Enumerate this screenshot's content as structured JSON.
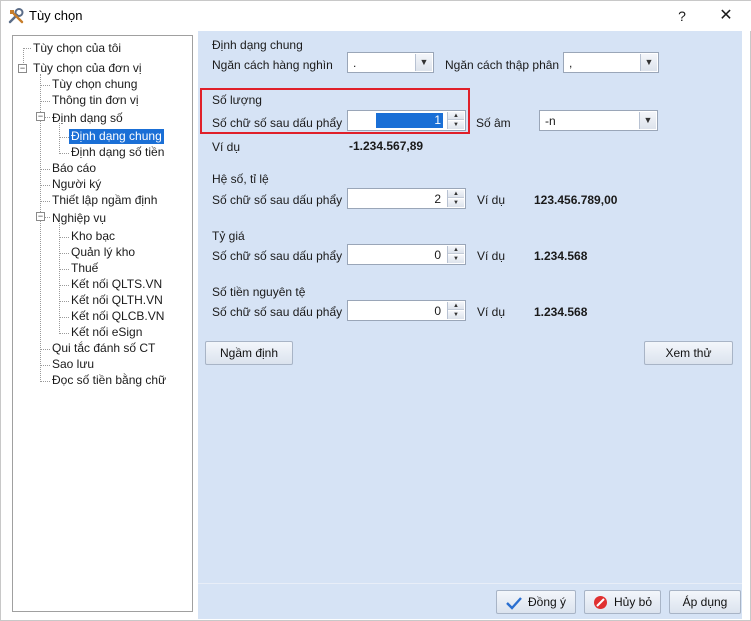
{
  "window": {
    "title": "Tùy chọn",
    "help": "?",
    "close": "✕"
  },
  "tree": {
    "items": [
      {
        "label": "Tùy chọn của tôi"
      },
      {
        "label": "Tùy chọn của đơn vị"
      },
      {
        "label": "Tùy chọn chung"
      },
      {
        "label": "Thông tin đơn vị"
      },
      {
        "label": "Định dạng số"
      },
      {
        "label": "Định dạng chung"
      },
      {
        "label": "Định dạng số tiền"
      },
      {
        "label": "Báo cáo"
      },
      {
        "label": "Người ký"
      },
      {
        "label": "Thiết lập ngầm định"
      },
      {
        "label": "Nghiệp vụ"
      },
      {
        "label": "Kho bạc"
      },
      {
        "label": "Quản lý kho"
      },
      {
        "label": "Thuế"
      },
      {
        "label": "Kết nối QLTS.VN"
      },
      {
        "label": "Kết nối QLTH.VN"
      },
      {
        "label": "Kết nối QLCB.VN"
      },
      {
        "label": "Kết nối eSign"
      },
      {
        "label": "Qui tắc đánh số CT"
      },
      {
        "label": "Sao lưu"
      },
      {
        "label": "Đọc số tiền bằng chữ"
      }
    ],
    "selected": "Định dạng chung",
    "toggle_expanded": "−"
  },
  "general": {
    "title": "Định dạng chung",
    "thousand_sep_label": "Ngăn cách hàng nghìn",
    "thousand_sep_value": ".",
    "decimal_sep_label": "Ngăn cách thập phân",
    "decimal_sep_value": ","
  },
  "quantity": {
    "title": "Số lượng",
    "decimals_label": "Số chữ số sau dấu phẩy",
    "decimals_value": "1",
    "negative_label": "Số âm",
    "negative_value": "-n",
    "example_label": "Ví dụ",
    "example_value": "-1.234.567,89"
  },
  "coefficient": {
    "title": "Hệ số, tỉ lệ",
    "decimals_label": "Số chữ số sau dấu phẩy",
    "decimals_value": "2",
    "example_label": "Ví dụ",
    "example_value": "123.456.789,00"
  },
  "rate": {
    "title": "Tỷ giá",
    "decimals_label": "Số chữ số sau dấu phẩy",
    "decimals_value": "0",
    "example_label": "Ví dụ",
    "example_value": "1.234.568"
  },
  "original_currency": {
    "title": "Số tiền nguyên tệ",
    "decimals_label": "Số chữ số sau dấu phẩy",
    "decimals_value": "0",
    "example_label": "Ví dụ",
    "example_value": "1.234.568"
  },
  "buttons": {
    "default": "Ngầm định",
    "preview": "Xem thử",
    "ok": "Đồng ý",
    "cancel": "Hủy bỏ",
    "apply": "Áp dụng"
  },
  "colors": {
    "panel_bg": "#d6e3f5",
    "selection": "#1a6fd6",
    "highlight_border": "#e0202a"
  }
}
